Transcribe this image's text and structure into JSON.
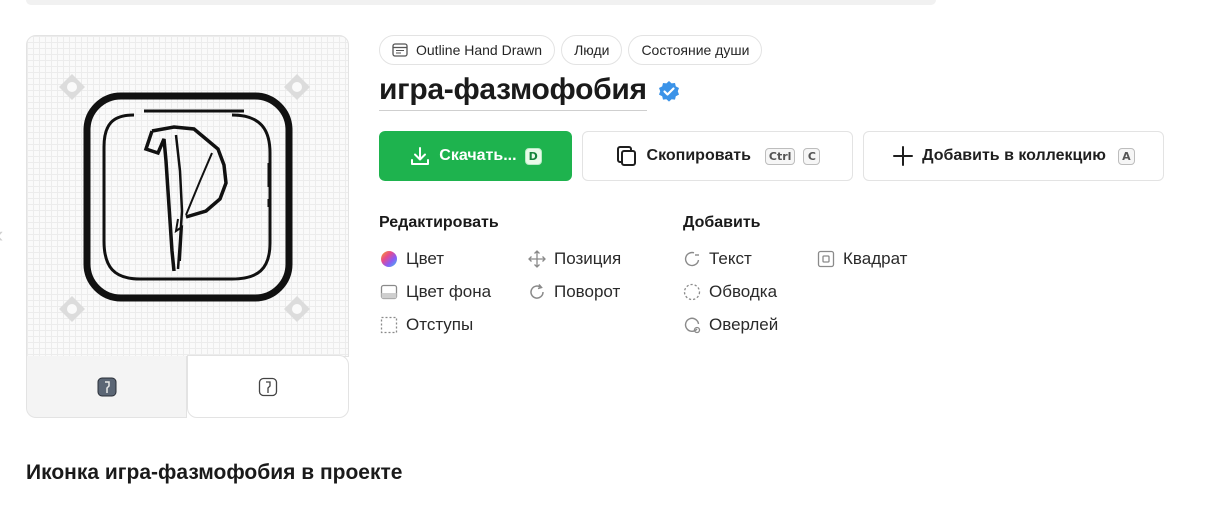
{
  "tags": [
    {
      "label": "Outline Hand Drawn",
      "icon": "style-icon"
    },
    {
      "label": "Люди"
    },
    {
      "label": "Состояние души"
    }
  ],
  "title": "игра-фазмофобия",
  "buttons": {
    "download": {
      "label": "Скачать...",
      "shortcut": "D"
    },
    "copy": {
      "label": "Скопировать",
      "shortcut_mod": "Ctrl",
      "shortcut": "C"
    },
    "collection": {
      "label": "Добавить в коллекцию",
      "shortcut": "A"
    }
  },
  "edit": {
    "heading": "Редактировать",
    "items": [
      "Цвет",
      "Позиция",
      "Цвет фона",
      "Поворот",
      "Отступы"
    ]
  },
  "add": {
    "heading": "Добавить",
    "items": [
      "Текст",
      "Квадрат",
      "Обводка",
      "Оверлей"
    ]
  },
  "bottom_heading": "Иконка игра-фазмофобия в проекте",
  "colors": {
    "accent": "#1eb34e",
    "verified": "#3b93e8"
  }
}
